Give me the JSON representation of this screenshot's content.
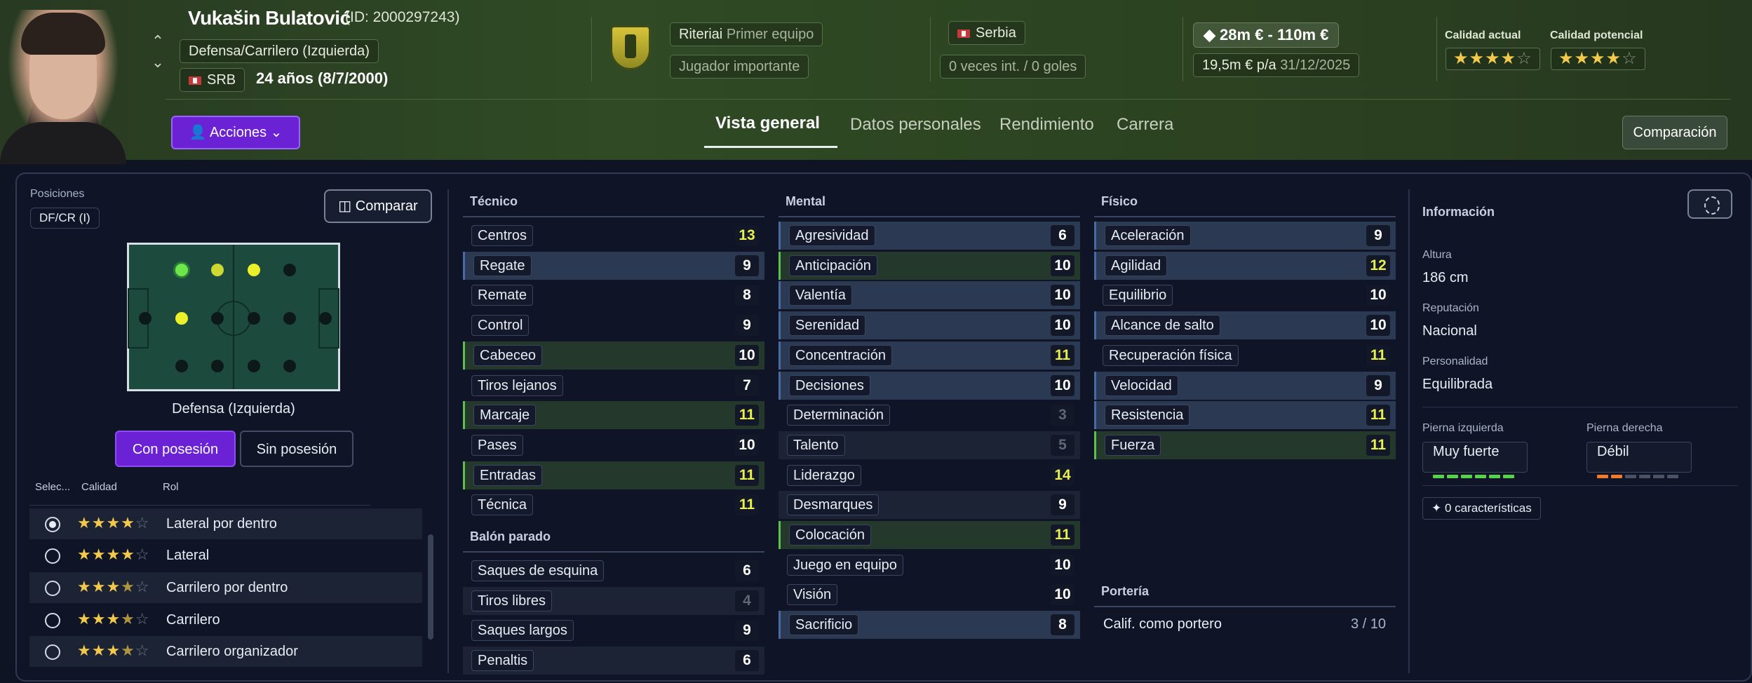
{
  "player": {
    "name": "Vukašin Bulatović",
    "id_text": "(ID: 2000297243)",
    "position_detail": "Defensa/Carrilero (Izquierda)",
    "nationality_code": "SRB",
    "age_text": "24 años (8/7/2000)",
    "actions_label": "Acciones"
  },
  "club": {
    "club_name_label": "Riteriai",
    "squad": "Primer equipo",
    "status": "Jugador importante"
  },
  "nation": {
    "name": "Serbia",
    "caps": "0 veces int. / 0 goles"
  },
  "contract": {
    "value_range": "28m € - 110m €",
    "wage": "19,5m € p/a",
    "expiry": "31/12/2025"
  },
  "quality": {
    "current_label": "Calidad actual",
    "potential_label": "Calidad potencial",
    "current_stars": 3.5,
    "potential_stars": 4
  },
  "tabs": [
    "Vista general",
    "Datos personales",
    "Rendimiento",
    "Carrera"
  ],
  "compare_button": "Comparación",
  "positions": {
    "label": "Posiciones",
    "chip": "DF/CR (I)",
    "compare_label": "Comparar",
    "pitch_label": "Defensa (Izquierda)",
    "possession_on": "Con posesión",
    "possession_off": "Sin posesión"
  },
  "roles": {
    "headers": [
      "Selec...",
      "Calidad",
      "Rol"
    ],
    "items": [
      {
        "stars": 4,
        "label": "Lateral por dentro",
        "selected": true
      },
      {
        "stars": 4,
        "label": "Lateral",
        "selected": false
      },
      {
        "stars": 3.5,
        "label": "Carrilero por dentro",
        "selected": false
      },
      {
        "stars": 3.5,
        "label": "Carrilero",
        "selected": false
      },
      {
        "stars": 3.5,
        "label": "Carrilero organizador",
        "selected": false
      }
    ]
  },
  "attributes": {
    "tecnico": {
      "title": "Técnico",
      "items": [
        {
          "name": "Centros",
          "value": "13"
        },
        {
          "name": "Regate",
          "value": "9"
        },
        {
          "name": "Remate",
          "value": "8"
        },
        {
          "name": "Control",
          "value": "9"
        },
        {
          "name": "Cabeceo",
          "value": "10"
        },
        {
          "name": "Tiros lejanos",
          "value": "7"
        },
        {
          "name": "Marcaje",
          "value": "11"
        },
        {
          "name": "Pases",
          "value": "10"
        },
        {
          "name": "Entradas",
          "value": "11"
        },
        {
          "name": "Técnica",
          "value": "11"
        }
      ]
    },
    "balon_parado": {
      "title": "Balón parado",
      "items": [
        {
          "name": "Saques de esquina",
          "value": "6"
        },
        {
          "name": "Tiros libres",
          "value": "4"
        },
        {
          "name": "Saques largos",
          "value": "9"
        },
        {
          "name": "Penaltis",
          "value": "6"
        }
      ]
    },
    "mental": {
      "title": "Mental",
      "items": [
        {
          "name": "Agresividad",
          "value": "6"
        },
        {
          "name": "Anticipación",
          "value": "10"
        },
        {
          "name": "Valentía",
          "value": "10"
        },
        {
          "name": "Serenidad",
          "value": "10"
        },
        {
          "name": "Concentración",
          "value": "11"
        },
        {
          "name": "Decisiones",
          "value": "10"
        },
        {
          "name": "Determinación",
          "value": "3"
        },
        {
          "name": "Talento",
          "value": "5"
        },
        {
          "name": "Liderazgo",
          "value": "14"
        },
        {
          "name": "Desmarques",
          "value": "9"
        },
        {
          "name": "Colocación",
          "value": "11"
        },
        {
          "name": "Juego en equipo",
          "value": "10"
        },
        {
          "name": "Visión",
          "value": "10"
        },
        {
          "name": "Sacrificio",
          "value": "8"
        }
      ]
    },
    "fisico": {
      "title": "Físico",
      "items": [
        {
          "name": "Aceleración",
          "value": "9"
        },
        {
          "name": "Agilidad",
          "value": "12"
        },
        {
          "name": "Equilibrio",
          "value": "10"
        },
        {
          "name": "Alcance de salto",
          "value": "10"
        },
        {
          "name": "Recuperación física",
          "value": "11"
        },
        {
          "name": "Velocidad",
          "value": "9"
        },
        {
          "name": "Resistencia",
          "value": "11"
        },
        {
          "name": "Fuerza",
          "value": "11"
        }
      ]
    },
    "porteria": {
      "title": "Portería",
      "rating_label": "Calif. como portero",
      "rating_value": "3 / 10"
    }
  },
  "info": {
    "title": "Información",
    "height_label": "Altura",
    "height_value": "186 cm",
    "reputation_label": "Reputación",
    "reputation_value": "Nacional",
    "personality_label": "Personalidad",
    "personality_value": "Equilibrada",
    "left_foot_label": "Pierna izquierda",
    "left_foot_value": "Muy fuerte",
    "left_foot_level": 5,
    "right_foot_label": "Pierna derecha",
    "right_foot_value": "Débil",
    "right_foot_level": 2,
    "characteristics": "0 características"
  },
  "colors": {
    "accent": "#6a22d4",
    "star": "#f2c94c",
    "high_value": "#e9f050",
    "strong_foot": "#55d44a",
    "weak_foot": "#f07a2a"
  }
}
